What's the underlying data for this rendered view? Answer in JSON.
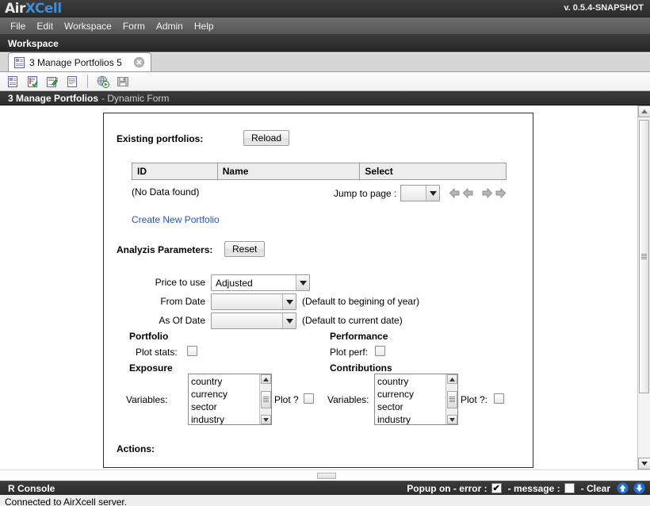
{
  "titlebar": {
    "logo_air": "Air",
    "logo_x": "X",
    "logo_cell": "Cell",
    "version": "v. 0.5.4-SNAPSHOT"
  },
  "menubar": {
    "items": [
      {
        "label": "File"
      },
      {
        "label": "Edit"
      },
      {
        "label": "Workspace"
      },
      {
        "label": "Form"
      },
      {
        "label": "Admin"
      },
      {
        "label": "Help"
      }
    ]
  },
  "workspacebar": {
    "label": "Workspace"
  },
  "tabs": [
    {
      "label": "3 Manage Portfolios 5",
      "icon": "document-icon",
      "close_icon": "close-icon"
    }
  ],
  "toolbar": {
    "icons": [
      "new-document-icon",
      "validate-document-icon",
      "edit-document-icon",
      "view-document-icon",
      "run-globe-icon",
      "save-icon"
    ]
  },
  "form_title": {
    "name": "3 Manage Portfolios",
    "suffix": "- Dynamic Form"
  },
  "form": {
    "existing_portfolios_label": "Existing portfolios:",
    "reload_button": "Reload",
    "table": {
      "columns": [
        "ID",
        "Name",
        "Select"
      ],
      "rows": [],
      "empty_message": "(No Data found)"
    },
    "pager": {
      "label": "Jump to page :",
      "selected_page": "",
      "first_icon": "first-page-arrow-icon",
      "prev_icon": "prev-page-arrow-icon",
      "next_icon": "next-page-arrow-icon",
      "last_icon": "last-page-arrow-icon"
    },
    "create_link": "Create New Portfolio",
    "analysis_label": "Analyzis Parameters:",
    "reset_button": "Reset",
    "fields": {
      "price_to_use": {
        "label": "Price to use",
        "value": "Adjusted",
        "hint": ""
      },
      "from_date": {
        "label": "From Date",
        "value": "",
        "hint": "(Default to begining of year)"
      },
      "as_of_date": {
        "label": "As Of Date",
        "value": "",
        "hint": "(Default to current date)"
      }
    },
    "portfolio": {
      "heading": "Portfolio",
      "plot_stats_label": "Plot stats:",
      "plot_stats_checked": false
    },
    "performance": {
      "heading": "Performance",
      "plot_perf_label": "Plot perf:",
      "plot_perf_checked": false
    },
    "exposure": {
      "heading": "Exposure",
      "variables_label": "Variables:",
      "options": [
        "country",
        "currency",
        "sector",
        "industry"
      ],
      "plot_label": "Plot ?",
      "plot_checked": false
    },
    "contributions": {
      "heading": "Contributions",
      "variables_label": "Variables:",
      "options": [
        "country",
        "currency",
        "sector",
        "industry"
      ],
      "plot_label": "Plot ?:",
      "plot_checked": false
    },
    "actions_label": "Actions:"
  },
  "console": {
    "title": "R Console",
    "popup_label": "Popup on - error :",
    "error_checked": true,
    "error_mark": "✔",
    "message_label": "- message :",
    "message_checked": false,
    "clear_label": "- Clear",
    "up_icon": "scroll-up-icon",
    "down_icon": "scroll-down-icon",
    "text": "Connected to AirXcell server."
  },
  "colors": {
    "accent": "#3a8fd6",
    "link": "#2255bb",
    "dark_bar": "#2e2e2e",
    "menu_bar": "#5f5f5f"
  }
}
